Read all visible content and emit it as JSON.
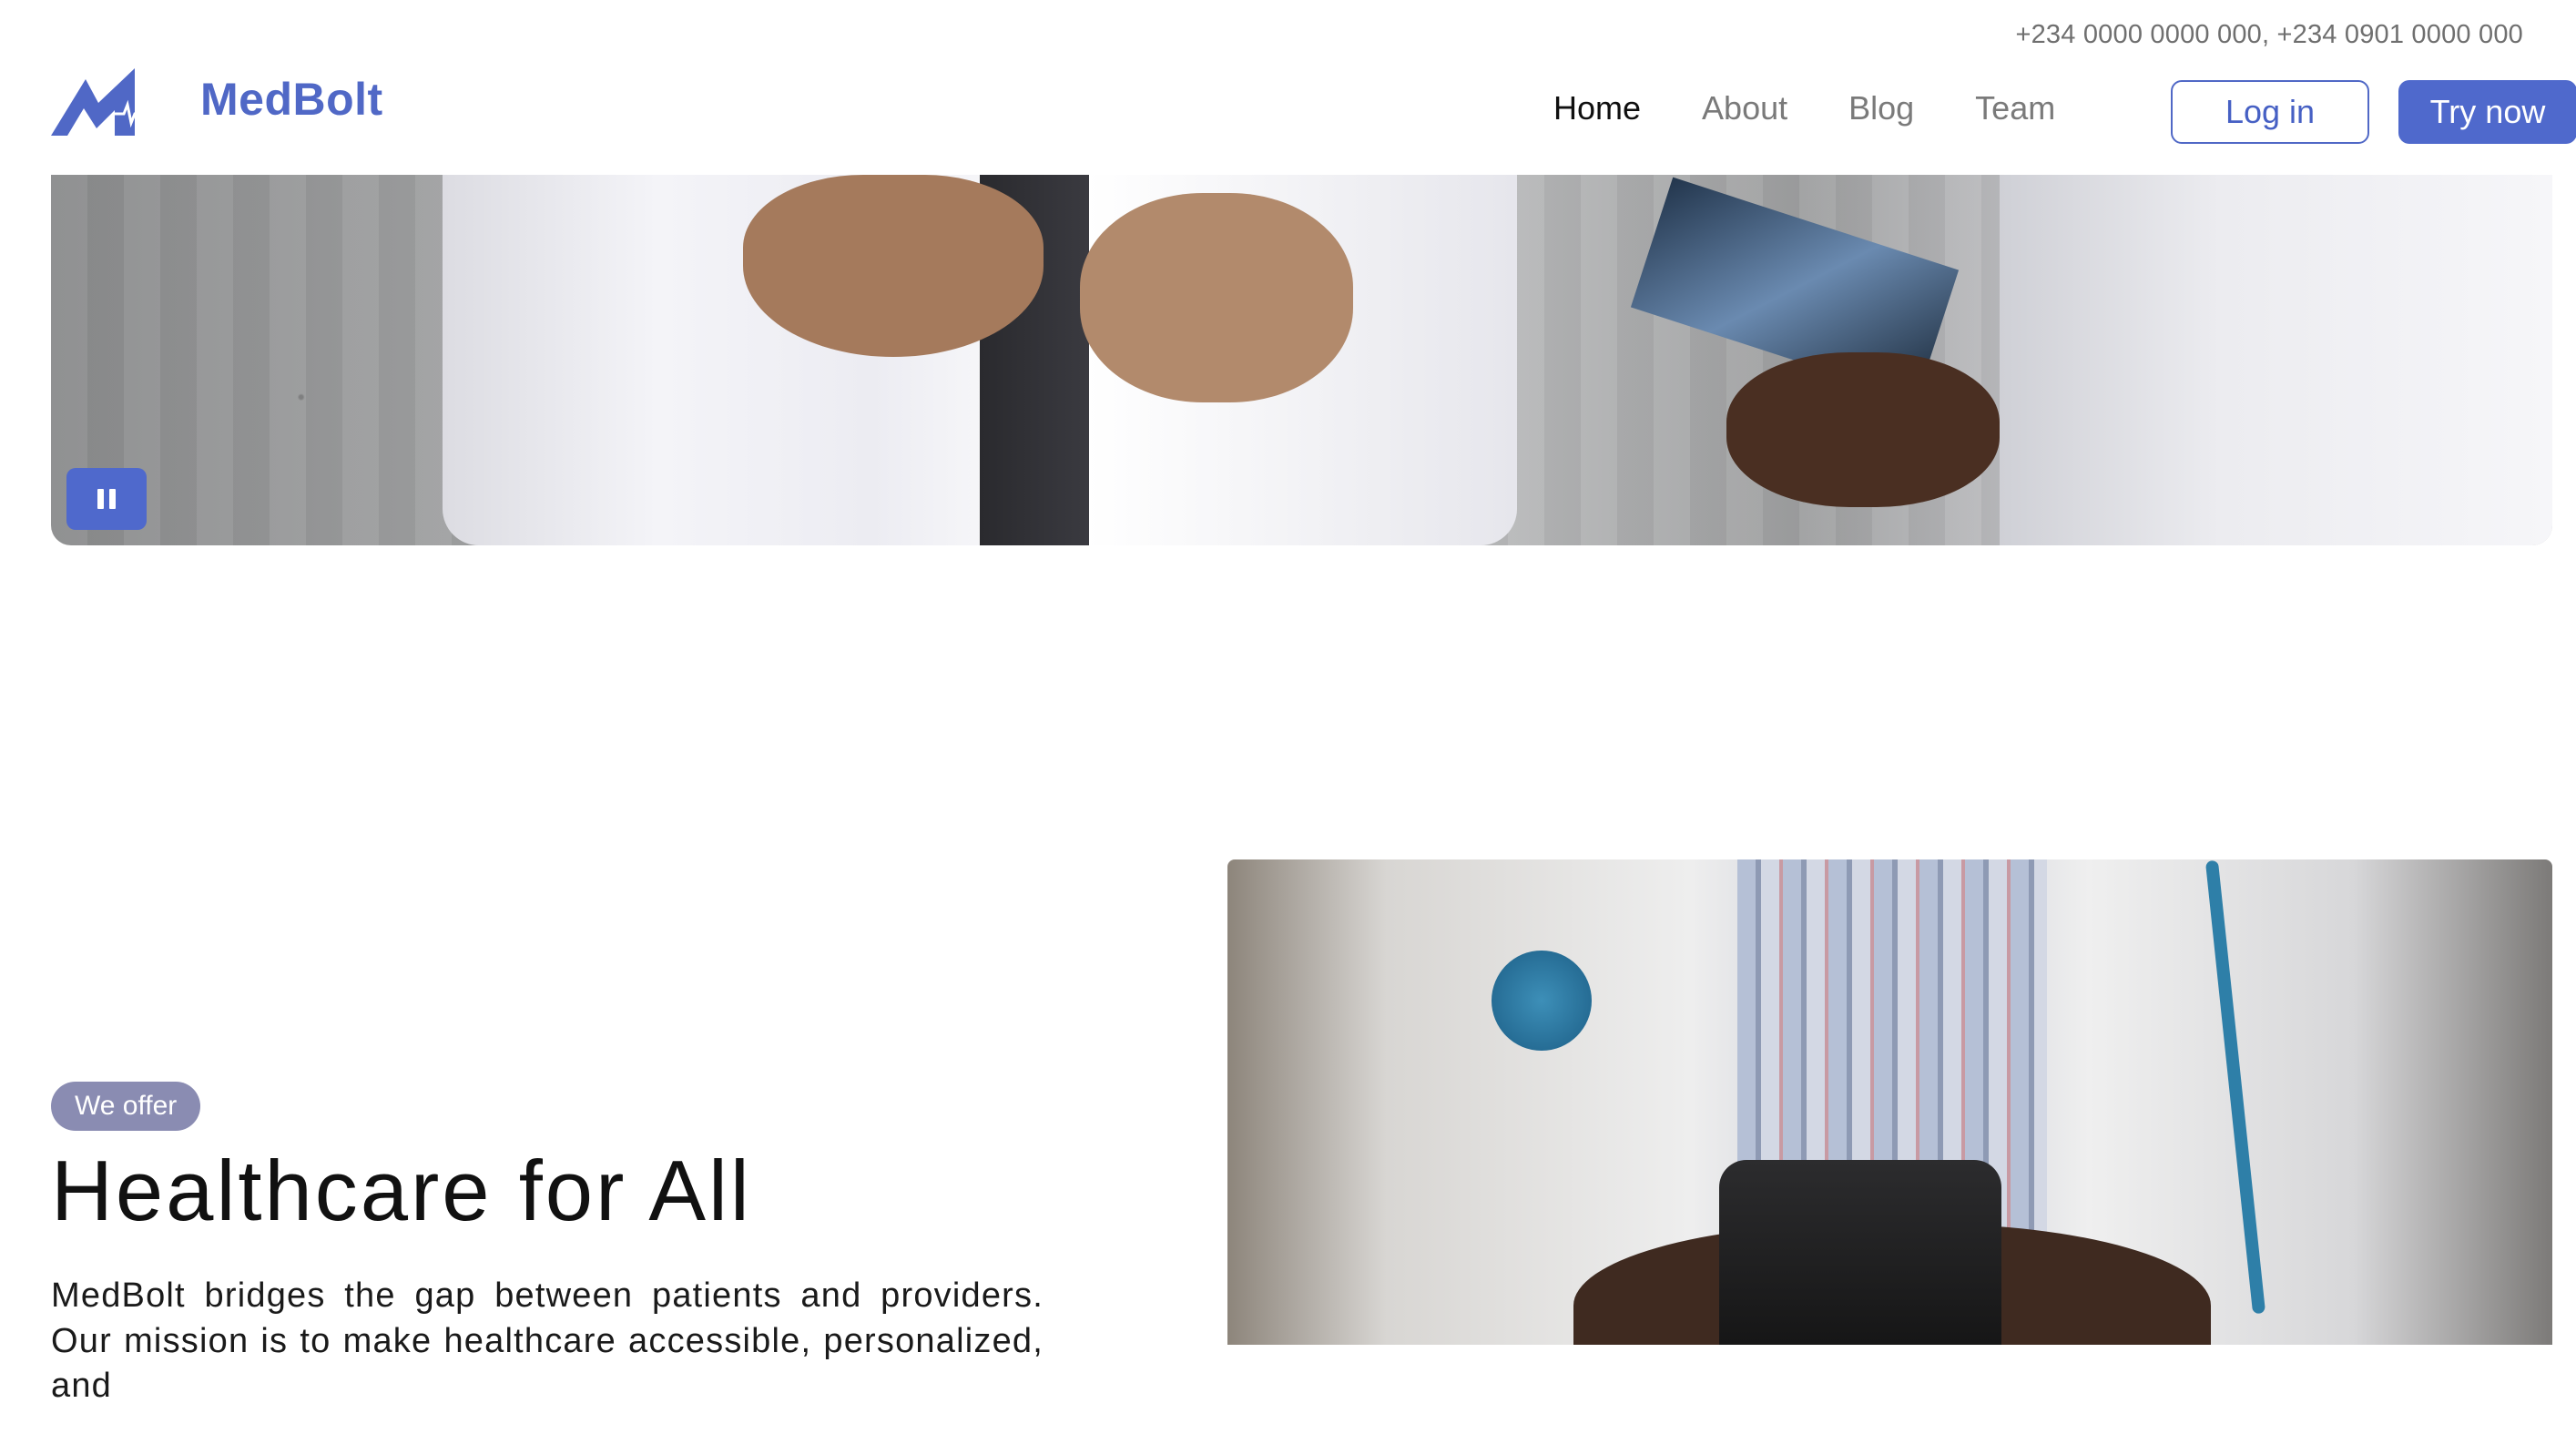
{
  "topbar": {
    "phones": "+234 0000 0000 000, +234 0901 0000 000"
  },
  "brand": {
    "name": "MedBolt",
    "logo_icon": "bolt-heartbeat-logo",
    "color": "#5068c6"
  },
  "nav": {
    "items": [
      {
        "label": "Home",
        "active": true
      },
      {
        "label": "About",
        "active": false
      },
      {
        "label": "Blog",
        "active": false
      },
      {
        "label": "Team",
        "active": false
      }
    ]
  },
  "actions": {
    "login_label": "Log in",
    "try_label": "Try now",
    "accent": "#4f69cc"
  },
  "hero": {
    "pause_icon": "pause-icon"
  },
  "offer": {
    "badge": "We offer",
    "headline": "Healthcare for All",
    "description": "MedBolt bridges the gap between patients and providers. Our mission is to make healthcare accessible, personalized, and"
  }
}
